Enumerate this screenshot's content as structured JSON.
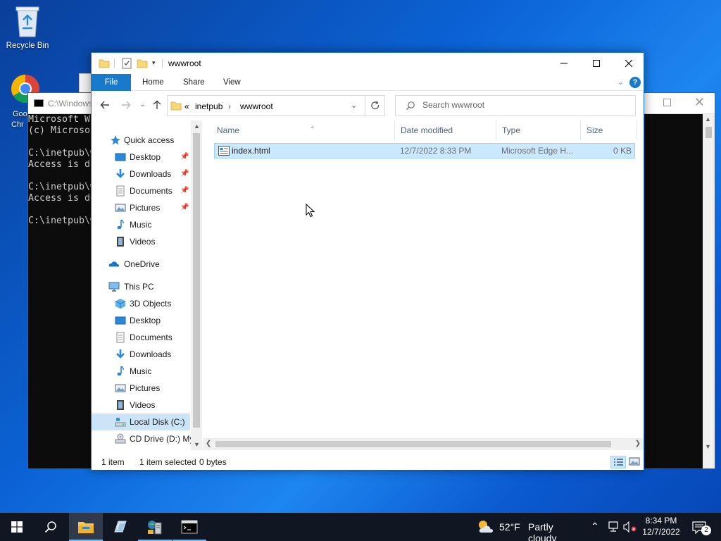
{
  "desktop": {
    "recycle_bin": "Recycle Bin",
    "chrome_label_1": "Goo",
    "chrome_label_2": "Chr"
  },
  "console": {
    "title": "C:\\Windows",
    "lines": "Microsoft W\n(c) Microso\n\nC:\\inetpub\\w\nAccess is de\n\nC:\\inetpub\\w\nAccess is de\n\nC:\\inetpub\\w"
  },
  "explorer": {
    "title": "wwwroot",
    "ribbon": {
      "file": "File",
      "home": "Home",
      "share": "Share",
      "view": "View"
    },
    "address": {
      "overflow": "«",
      "seg1": "inetpub",
      "sep": "›",
      "seg2": "wwwroot"
    },
    "search": {
      "placeholder": "Search wwwroot"
    },
    "nav": {
      "quick_access": "Quick access",
      "qa_items": [
        "Desktop",
        "Downloads",
        "Documents",
        "Pictures",
        "Music",
        "Videos"
      ],
      "onedrive": "OneDrive",
      "this_pc": "This PC",
      "pc_items": [
        "3D Objects",
        "Desktop",
        "Documents",
        "Downloads",
        "Music",
        "Pictures",
        "Videos",
        "Local Disk (C:)",
        "CD Drive (D:) My"
      ]
    },
    "columns": {
      "name": "Name",
      "date": "Date modified",
      "type": "Type",
      "size": "Size"
    },
    "files": [
      {
        "name": "index.html",
        "date": "12/7/2022 8:33 PM",
        "type": "Microsoft Edge H...",
        "size": "0 KB"
      }
    ],
    "status": {
      "count": "1 item",
      "selected": "1 item selected",
      "bytes": "0 bytes"
    }
  },
  "taskbar": {
    "weather_temp": "52°F",
    "weather_text": "Partly cloudy",
    "time": "8:34 PM",
    "date": "12/7/2022",
    "notification_count": "2"
  }
}
